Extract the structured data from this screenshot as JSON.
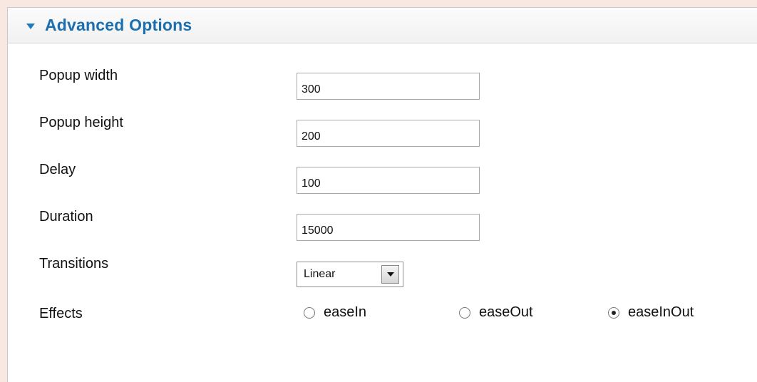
{
  "panel": {
    "title": "Advanced Options"
  },
  "fields": [
    {
      "label": "Popup width",
      "value": "300"
    },
    {
      "label": "Popup height",
      "value": "200"
    },
    {
      "label": "Delay",
      "value": "100"
    },
    {
      "label": "Duration",
      "value": "15000"
    }
  ],
  "transitions": {
    "label": "Transitions",
    "selected": "Linear"
  },
  "effects": {
    "label": "Effects",
    "options": [
      {
        "label": "easeIn",
        "checked": false
      },
      {
        "label": "easeOut",
        "checked": false
      },
      {
        "label": "easeInOut",
        "checked": true
      }
    ]
  },
  "colors": {
    "title": "#1b6fb0",
    "toggle_arrow": "#1e7bbf",
    "page_background": "#f9e7e1"
  },
  "icons": {
    "toggle": "triangle-down-icon",
    "select": "chevron-down-icon"
  }
}
